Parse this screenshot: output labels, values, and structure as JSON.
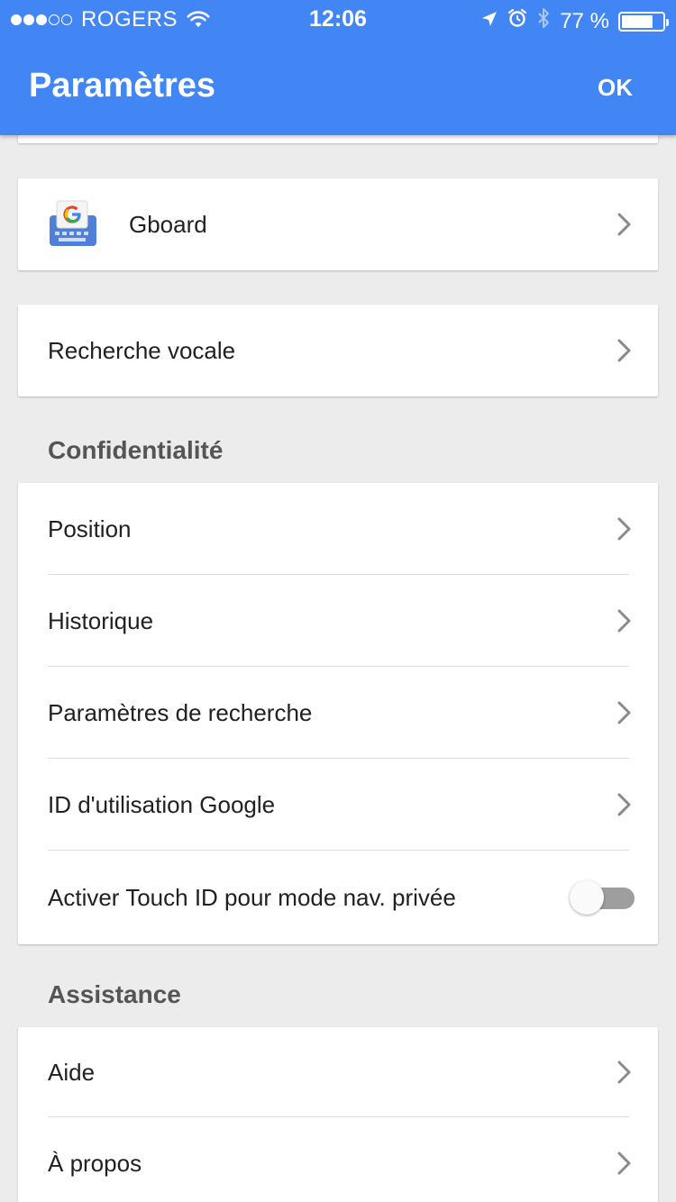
{
  "status_bar": {
    "carrier": "ROGERS",
    "time": "12:06",
    "battery": "77 %",
    "battery_level": 0.77,
    "signal_bars_filled": 3,
    "signal_bars_total": 5
  },
  "app_bar": {
    "title": "Paramètres",
    "ok_label": "OK"
  },
  "sections": {
    "gboard": {
      "label": "Gboard"
    },
    "voice": {
      "label": "Recherche vocale"
    },
    "privacy": {
      "header": "Confidentialité",
      "items": [
        {
          "label": "Position"
        },
        {
          "label": "Historique"
        },
        {
          "label": "Paramètres de recherche"
        },
        {
          "label": "ID d'utilisation Google"
        },
        {
          "label": "Activer Touch ID pour mode nav. privée",
          "toggle": false
        }
      ]
    },
    "support": {
      "header": "Assistance",
      "items": [
        {
          "label": "Aide"
        },
        {
          "label": "À propos"
        }
      ]
    }
  },
  "colors": {
    "app_bar": "#4285f4",
    "background": "#ececec",
    "chevron": "#8a8a8a",
    "toggle_off_track": "#9e9e9e"
  },
  "icons": {
    "chevron": "chevron-right-icon",
    "gboard": "gboard-app-icon"
  }
}
